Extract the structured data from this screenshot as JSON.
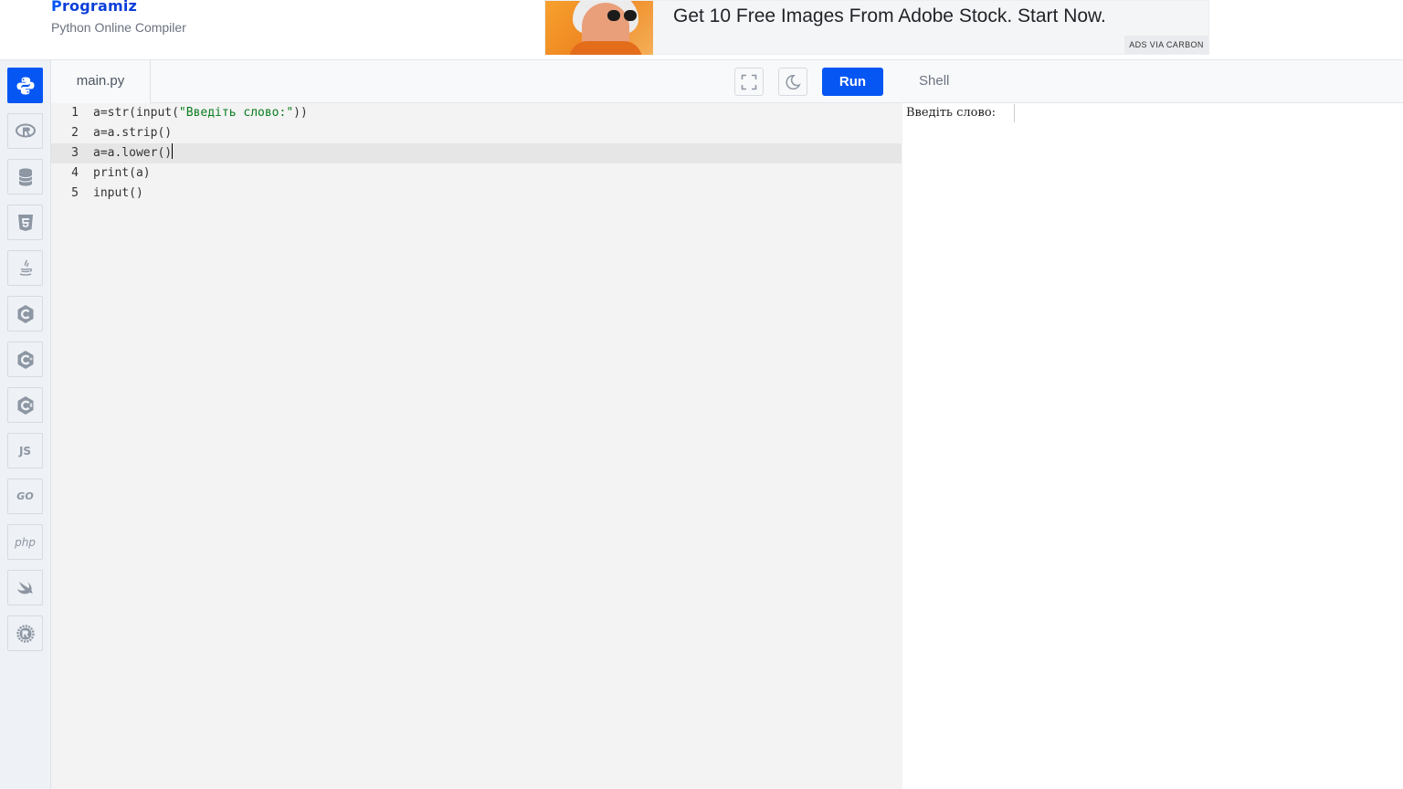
{
  "header": {
    "logo_text": "rogramiz",
    "logo_first": "P",
    "subtitle": "Python Online Compiler"
  },
  "ad": {
    "text": "Get 10 Free Images From Adobe Stock. Start Now.",
    "tag": "ADS VIA CARBON"
  },
  "sidebar": {
    "items": [
      {
        "name": "python",
        "icon": "python-icon",
        "active": true
      },
      {
        "name": "r",
        "icon": "r-icon",
        "active": false
      },
      {
        "name": "sql",
        "icon": "database-icon",
        "active": false
      },
      {
        "name": "html",
        "icon": "html5-icon",
        "active": false
      },
      {
        "name": "java",
        "icon": "java-icon",
        "active": false
      },
      {
        "name": "c",
        "icon": "c-icon",
        "active": false
      },
      {
        "name": "cpp",
        "icon": "cpp-icon",
        "active": false
      },
      {
        "name": "csharp",
        "icon": "csharp-icon",
        "active": false
      },
      {
        "name": "javascript",
        "icon": "js-icon",
        "label": "JS",
        "active": false
      },
      {
        "name": "go",
        "icon": "go-icon",
        "label": "GO",
        "active": false
      },
      {
        "name": "php",
        "icon": "php-icon",
        "label": "php",
        "active": false
      },
      {
        "name": "swift",
        "icon": "swift-icon",
        "active": false
      },
      {
        "name": "rust",
        "icon": "rust-icon",
        "active": false
      }
    ]
  },
  "editor": {
    "tab_label": "main.py",
    "run_label": "Run",
    "lines": [
      {
        "num": "1",
        "code": "a=str(input(\"Введіть слово:\"))"
      },
      {
        "num": "2",
        "code": "a=a.strip()"
      },
      {
        "num": "3",
        "code": "a=a.lower()"
      },
      {
        "num": "4",
        "code": "print(a)"
      },
      {
        "num": "5",
        "code": "input()"
      }
    ],
    "active_line": 3
  },
  "shell": {
    "title": "Shell",
    "output": "Введіть слово:"
  },
  "colors": {
    "accent": "#0556f3",
    "string": "#0a7d1e"
  }
}
